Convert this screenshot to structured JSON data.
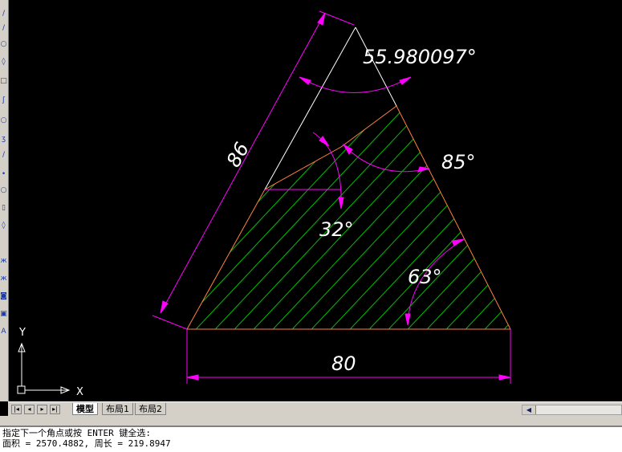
{
  "drawing": {
    "dim_side": "86",
    "dim_base": "80",
    "angle_top": "55.980097°",
    "angle_right": "85°",
    "angle_inner": "32°",
    "angle_bottom_right": "63°",
    "ucs_x": "X",
    "ucs_y": "Y"
  },
  "tabs": {
    "model": "模型",
    "layout1": "布局1",
    "layout2": "布局2"
  },
  "command": {
    "line1": "指定下一个角点或按 ENTER 键全选:",
    "line2": "面积 = 2570.4882, 周长 = 219.8947"
  },
  "colors": {
    "background": "#000000",
    "dimension": "#ff00ff",
    "hatch": "#00c000",
    "boundary": "#ff8040",
    "outline": "#ffffff"
  }
}
